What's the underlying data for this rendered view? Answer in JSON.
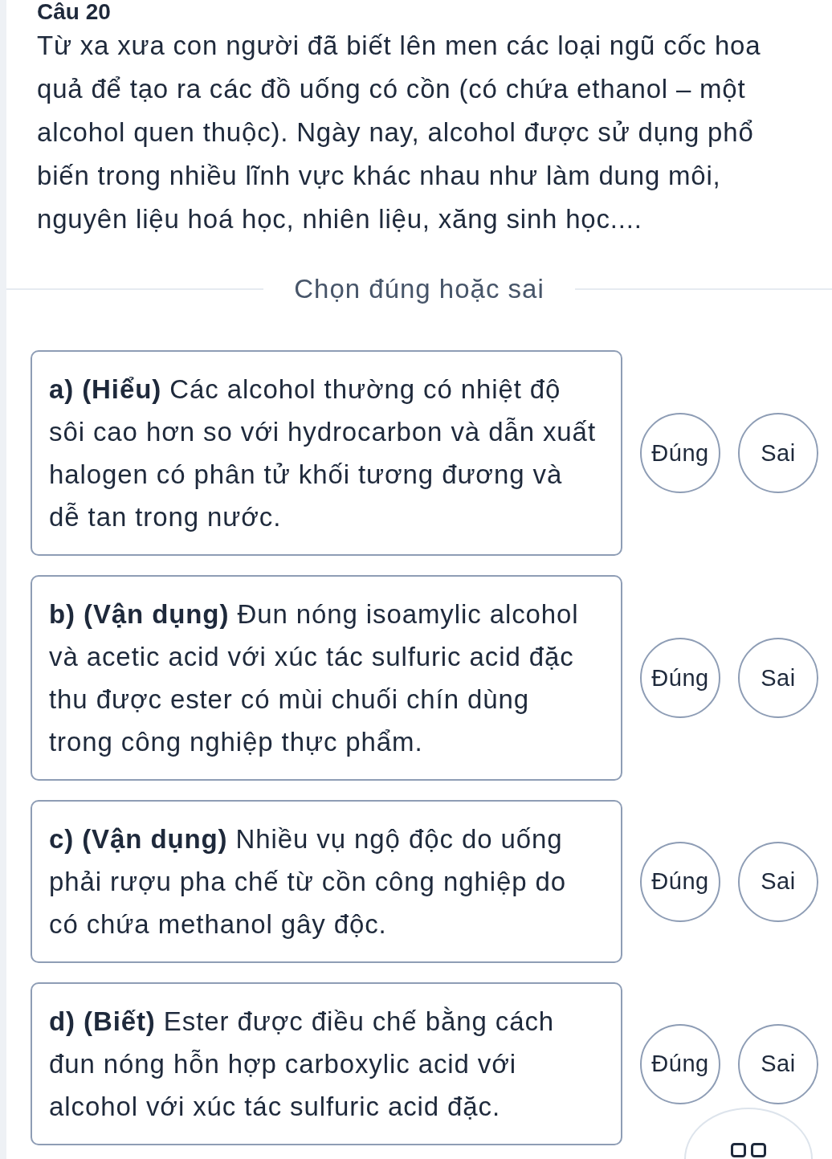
{
  "question": {
    "number": "Câu 20",
    "intro": "Từ xa xưa con người đã biết lên men các loại ngũ cốc hoa quả để tạo ra các đồ uống có cồn (có chứa ethanol – một alcohol quen thuộc). Ngày nay, alcohol được sử dụng phổ biến trong nhiều lĩnh vực khác nhau như làm dung môi, nguyên liệu hoá học, nhiên liệu, xăng sinh học...."
  },
  "section": {
    "title": "Chọn đúng hoặc sai"
  },
  "statements": [
    {
      "text": "**a) (Hiểu)** Các alcohol thường có nhiệt độ sôi cao hơn so với hydrocarbon và dẫn xuất halogen có phân tử khối tương đương và dễ tan trong nước.",
      "options": [
        {
          "label": "Đúng",
          "selected": false
        },
        {
          "label": "Sai",
          "selected": false
        }
      ]
    },
    {
      "text": "**b) (Vận dụng)** Đun nóng isoamylic alcohol và acetic acid với xúc tác sulfuric acid đặc thu được ester có mùi chuối chín dùng trong công nghiệp thực phẩm.",
      "options": [
        {
          "label": "Đúng",
          "selected": false
        },
        {
          "label": "Sai",
          "selected": false
        }
      ]
    },
    {
      "text": "**c) (Vận dụng)** Nhiều vụ ngộ độc do uống phải rượu pha chế từ cồn công nghiệp do có chứa methanol gây độc.",
      "options": [
        {
          "label": "Đúng",
          "selected": false
        },
        {
          "label": "Sai",
          "selected": false
        }
      ]
    },
    {
      "text": "**d) (Biết)** Ester được điều chế bằng cách đun nóng hỗn hợp carboxylic acid với alcohol với xúc tác sulfuric acid đặc.",
      "options": [
        {
          "label": "Đúng",
          "selected": false
        },
        {
          "label": "Sai",
          "selected": false
        }
      ]
    }
  ]
}
